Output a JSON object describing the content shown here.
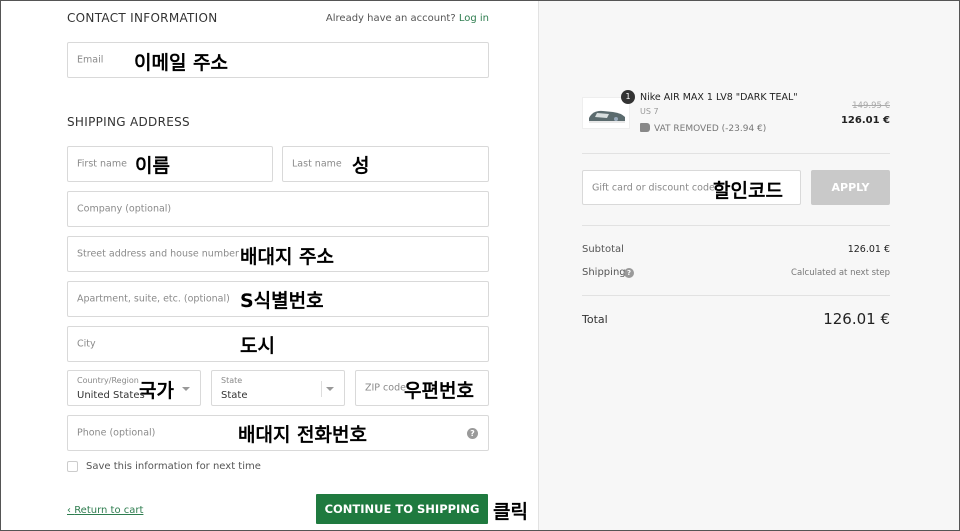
{
  "contact": {
    "title": "CONTACT INFORMATION",
    "have_account": "Already have an account?",
    "login_link": "Log in",
    "email_placeholder": "Email",
    "email_annotation": "이메일 주소"
  },
  "shipping": {
    "title": "SHIPPING ADDRESS",
    "first_name_placeholder": "First name",
    "first_name_annotation": "이름",
    "last_name_placeholder": "Last name",
    "last_name_annotation": "성",
    "company_placeholder": "Company (optional)",
    "street_placeholder": "Street address and house number",
    "street_annotation": "배대지 주소",
    "apartment_placeholder": "Apartment, suite, etc. (optional)",
    "apartment_annotation": "S식별번호",
    "city_placeholder": "City",
    "city_annotation": "도시",
    "country_label": "Country/Region",
    "country_value": "United States",
    "country_annotation": "국가",
    "state_label": "State",
    "state_value": "State",
    "zip_placeholder": "ZIP code",
    "zip_annotation": "우편번호",
    "phone_placeholder": "Phone (optional)",
    "phone_annotation": "배대지 전화번호",
    "save_info_label": "Save this information for next time",
    "return_link": "Return to cart",
    "continue_button": "CONTINUE TO SHIPPING",
    "continue_annotation": "클릭"
  },
  "order": {
    "quantity": "1",
    "product_name": "Nike AIR MAX 1 LV8 \"DARK TEAL\"",
    "product_size": "US 7",
    "vat_note": "VAT REMOVED (-23.94 €)",
    "old_price": "149.95 €",
    "price": "126.01 €",
    "discount_placeholder": "Gift card or discount code",
    "discount_annotation": "할인코드",
    "apply_button": "APPLY",
    "subtotal_label": "Subtotal",
    "subtotal_value": "126.01 €",
    "shipping_label": "Shipping",
    "shipping_value": "Calculated at next step",
    "total_label": "Total",
    "total_value": "126.01 €"
  },
  "icons": {
    "help": "question-circle-icon",
    "tag": "tag-icon",
    "back": "chevron-left-icon",
    "dropdown": "chevron-down-icon"
  },
  "colors": {
    "accent": "#1f7a3f",
    "link": "#2e7d4f",
    "apply_disabled": "#c9c9c9"
  }
}
